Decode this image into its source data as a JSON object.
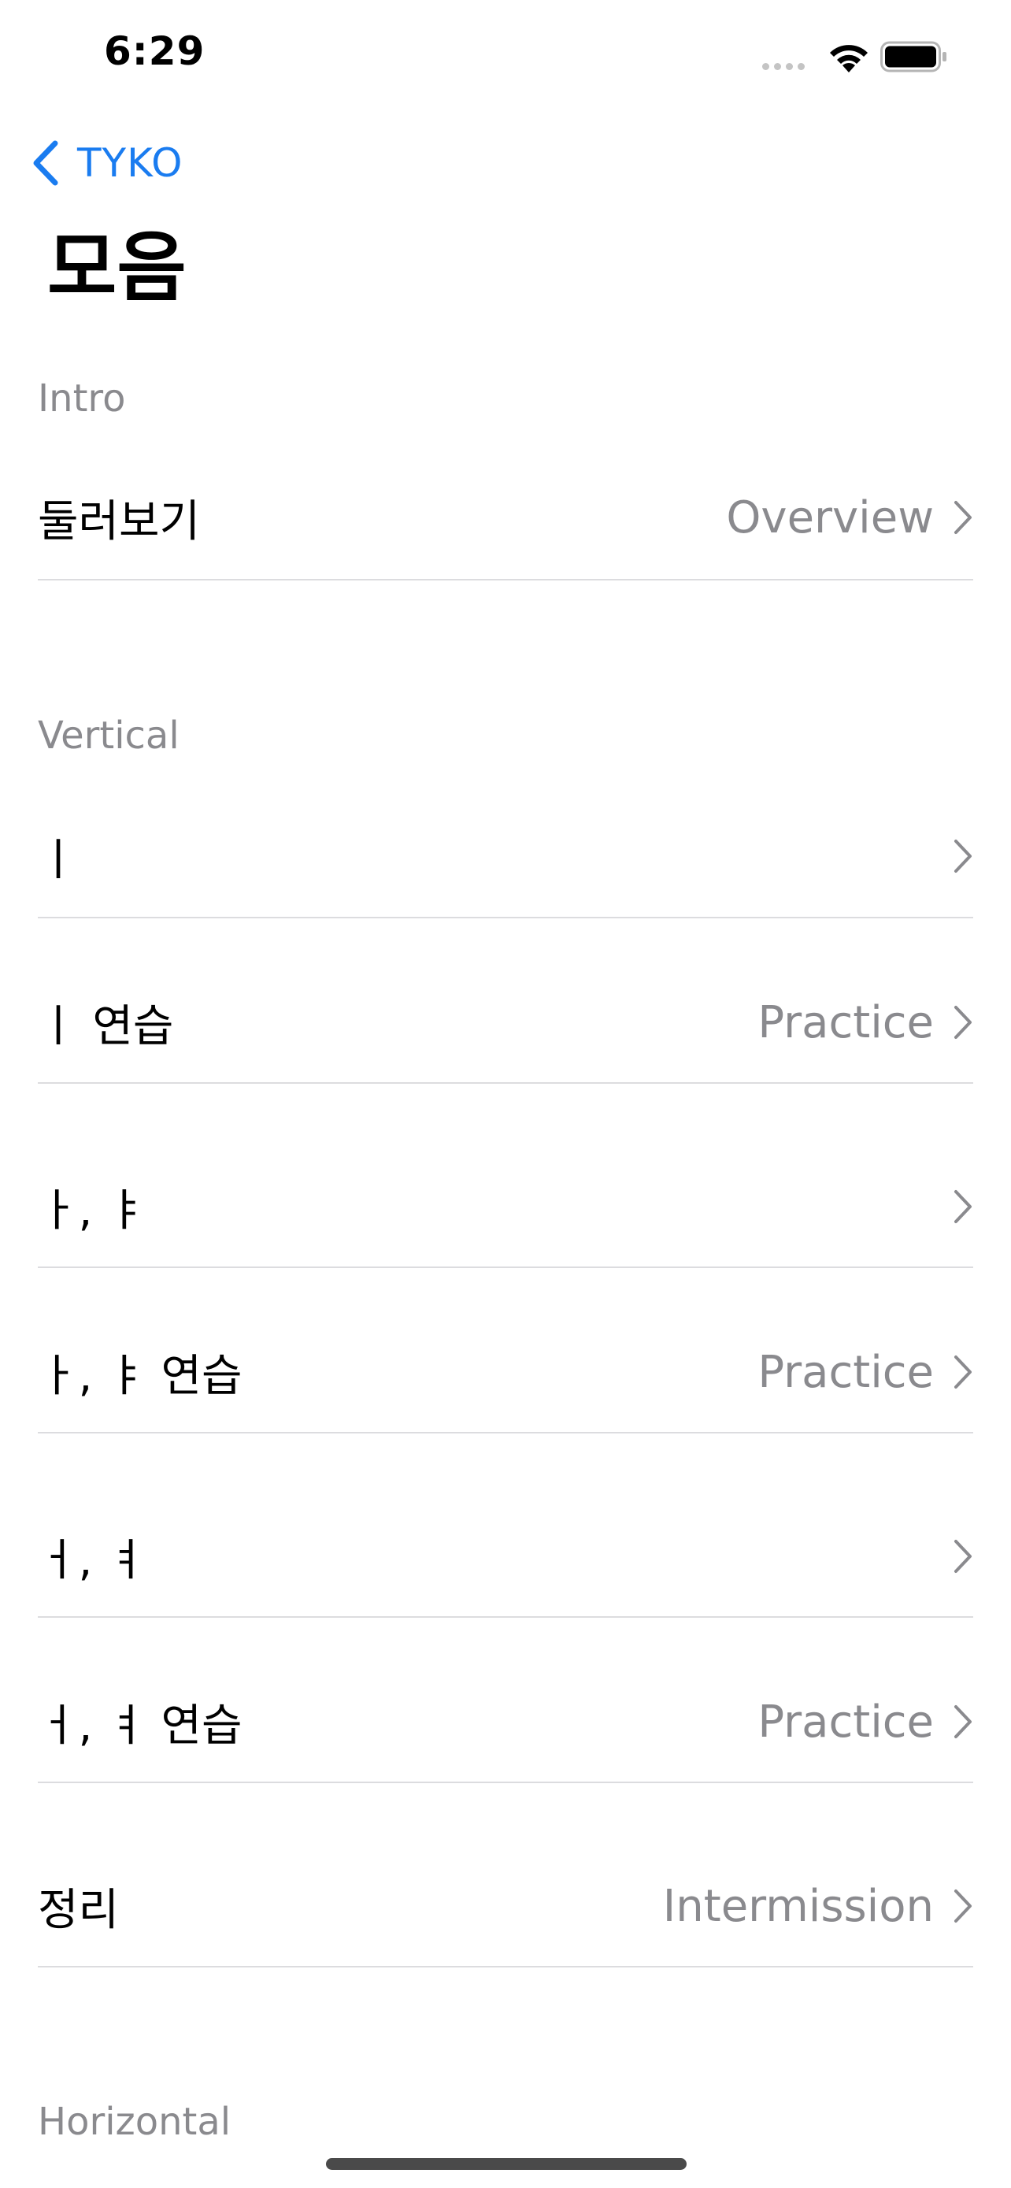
{
  "status_bar": {
    "time": "6:29"
  },
  "nav": {
    "back_label": "TYKO",
    "title": "모음"
  },
  "sections": [
    {
      "header": "Intro",
      "rows": [
        {
          "title": "둘러보기",
          "detail": "Overview"
        }
      ]
    },
    {
      "header": "Vertical",
      "rows": [
        {
          "title": "ㅣ",
          "detail": ""
        },
        {
          "title": "ㅣ 연습",
          "detail": "Practice"
        },
        {
          "title": "ㅏ, ㅑ",
          "detail": ""
        },
        {
          "title": "ㅏ, ㅑ 연습",
          "detail": "Practice"
        },
        {
          "title": "ㅓ, ㅕ",
          "detail": ""
        },
        {
          "title": "ㅓ, ㅕ 연습",
          "detail": "Practice"
        },
        {
          "title": "정리",
          "detail": "Intermission"
        }
      ]
    },
    {
      "header": "Horizontal",
      "rows": []
    }
  ],
  "colors": {
    "accent": "#1a7cf0",
    "secondary_text": "#8a8a8e",
    "divider": "#dcdcdf"
  },
  "icons": {
    "back": "chevron-left-icon",
    "disclosure": "chevron-right-icon",
    "wifi": "wifi-icon",
    "battery": "battery-icon"
  }
}
